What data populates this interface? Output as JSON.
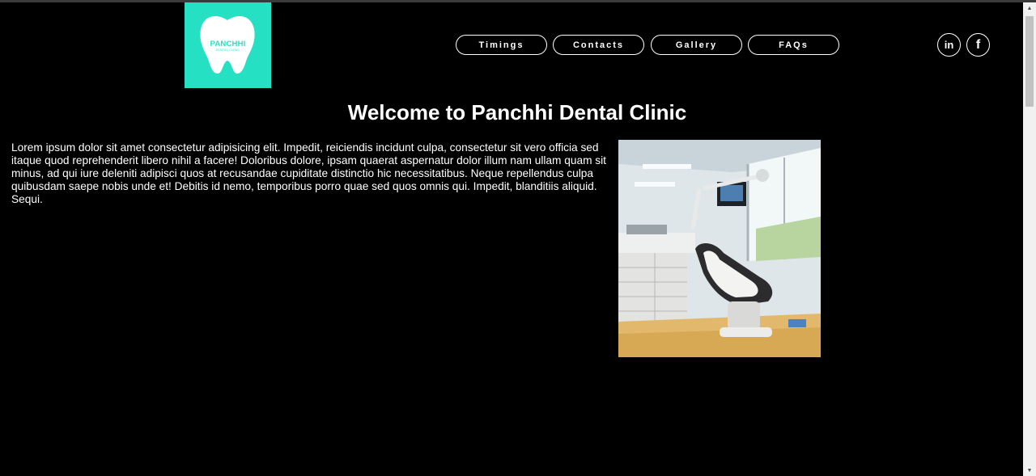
{
  "logo": {
    "name": "PANCHHI",
    "tagline": "DENTAL CLINIC",
    "color": "#26e0c3"
  },
  "nav": {
    "items": [
      {
        "label": "Timings"
      },
      {
        "label": "Contacts"
      },
      {
        "label": "Gallery"
      },
      {
        "label": "FAQs"
      }
    ]
  },
  "social": {
    "linkedin": {
      "icon": "linkedin-icon",
      "glyph": "in"
    },
    "facebook": {
      "icon": "facebook-icon",
      "glyph": "f"
    }
  },
  "main": {
    "title": "Welcome to Panchhi Dental Clinic",
    "paragraph": "Lorem ipsum dolor sit amet consectetur adipisicing elit. Impedit, reiciendis incidunt culpa, consectetur sit vero officia sed itaque quod reprehenderit libero nihil a facere! Doloribus dolore, ipsam quaerat aspernatur dolor illum nam ullam quam sit minus, ad qui iure deleniti adipisci quos at recusandae cupiditate distinctio hic necessitatibus. Neque repellendus culpa quibusdam saepe nobis unde et! Debitis id nemo, temporibus porro quae sed quos omnis qui. Impedit, blanditiis aliquid. Sequi."
  },
  "scrollbar": {
    "up": "▲",
    "down": "▼"
  }
}
